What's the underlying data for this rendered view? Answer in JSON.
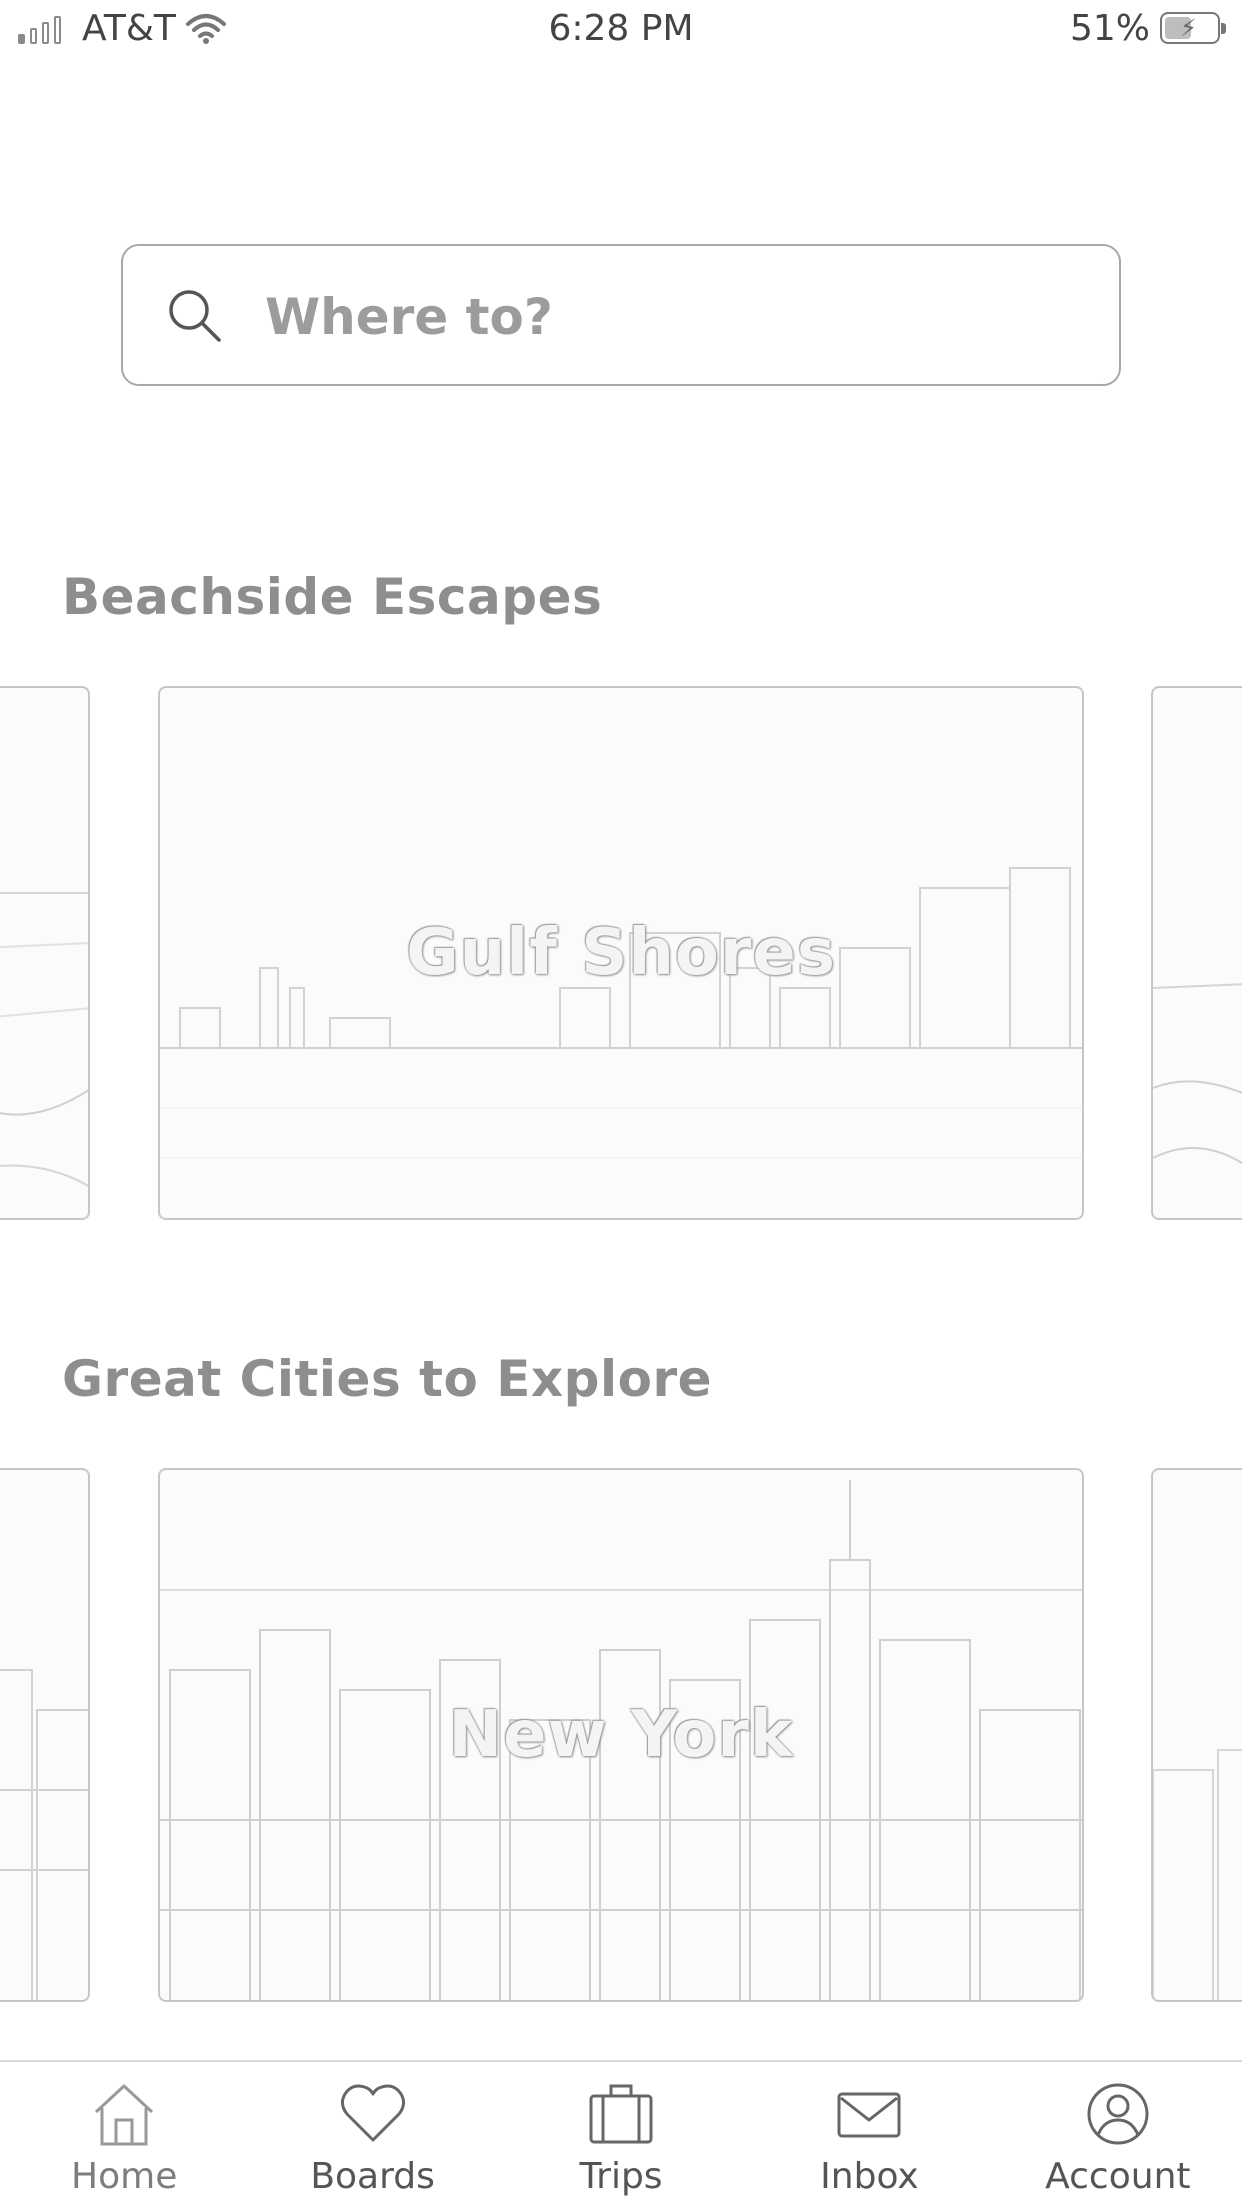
{
  "status_bar": {
    "carrier": "AT&T",
    "time": "6:28 PM",
    "battery_percent": "51%",
    "signal_bars_filled": 1,
    "signal_bars_total": 4,
    "battery_level": 0.51,
    "charging": true
  },
  "search": {
    "placeholder": "Where to?"
  },
  "sections": [
    {
      "title": "Beachside Escapes",
      "featured_card": {
        "label": "Gulf Shores"
      }
    },
    {
      "title": "Great Cities to Explore",
      "featured_card": {
        "label": "New York"
      }
    }
  ],
  "tab_bar": {
    "tabs": [
      {
        "label": "Home",
        "icon": "home-icon",
        "active": true
      },
      {
        "label": "Boards",
        "icon": "heart-icon",
        "active": false
      },
      {
        "label": "Trips",
        "icon": "suitcase-icon",
        "active": false
      },
      {
        "label": "Inbox",
        "icon": "envelope-icon",
        "active": false
      },
      {
        "label": "Account",
        "icon": "user-circle-icon",
        "active": false
      }
    ]
  }
}
